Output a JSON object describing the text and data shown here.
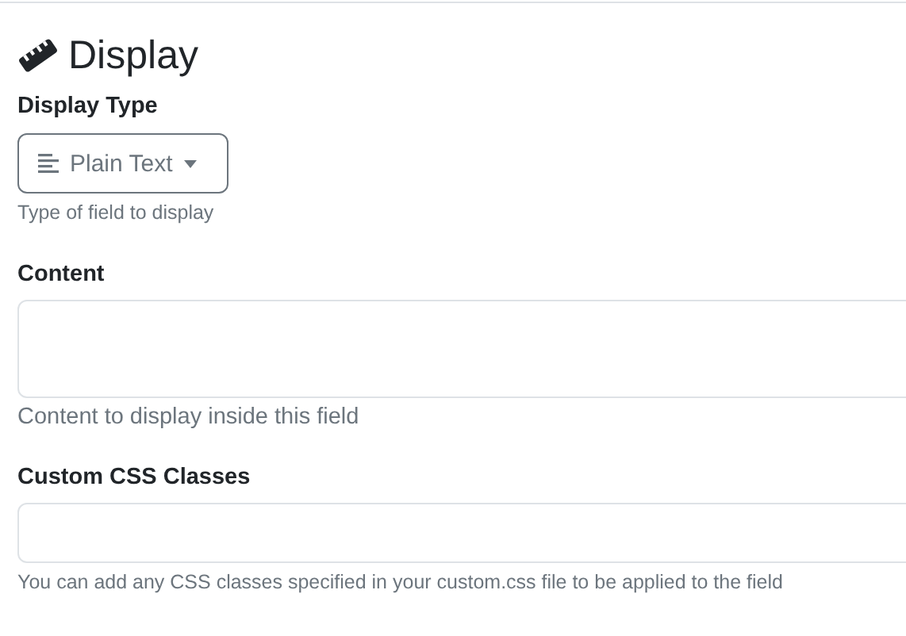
{
  "section": {
    "title": "Display"
  },
  "fields": [
    {
      "kind": "dropdown",
      "label": "Display Type",
      "value": "Plain Text",
      "help": "Type of field to display"
    },
    {
      "kind": "textarea",
      "label": "Content",
      "help": "Content to display inside this field"
    },
    {
      "kind": "input",
      "label": "Custom CSS Classes",
      "help": "You can add any CSS classes specified in your custom.css file to be applied to the field"
    }
  ]
}
